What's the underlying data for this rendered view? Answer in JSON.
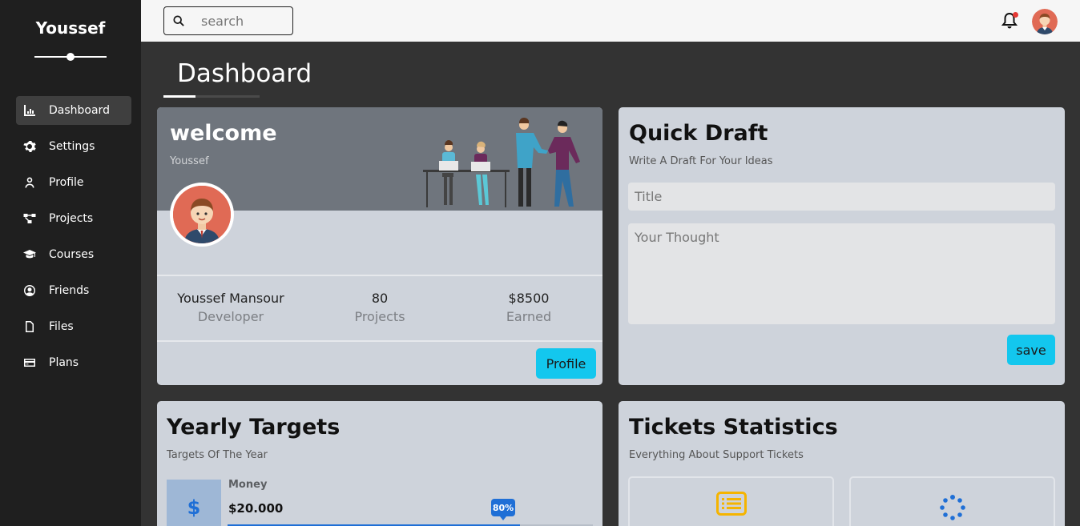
{
  "sidebar": {
    "brand": "Youssef",
    "items": [
      {
        "label": "Dashboard",
        "icon": "chart-icon",
        "active": true
      },
      {
        "label": "Settings",
        "icon": "gear-icon"
      },
      {
        "label": "Profile",
        "icon": "user-icon"
      },
      {
        "label": "Projects",
        "icon": "diagram-icon"
      },
      {
        "label": "Courses",
        "icon": "graduation-cap-icon"
      },
      {
        "label": "Friends",
        "icon": "user-circle-icon"
      },
      {
        "label": "Files",
        "icon": "file-icon"
      },
      {
        "label": "Plans",
        "icon": "credit-card-icon"
      }
    ]
  },
  "topbar": {
    "search_placeholder": "search",
    "search_icon": "search-icon",
    "bell_icon": "bell-icon",
    "avatar_icon": "avatar-icon"
  },
  "page": {
    "title": "Dashboard"
  },
  "welcome": {
    "title": "welcome",
    "subtitle": "Youssef",
    "stats": [
      {
        "value": "Youssef Mansour",
        "label": "Developer"
      },
      {
        "value": "80",
        "label": "Projects"
      },
      {
        "value": "$8500",
        "label": "Earned"
      }
    ],
    "button": "Profile"
  },
  "draft": {
    "title": "Quick Draft",
    "subtitle": "Write A Draft For Your Ideas",
    "title_placeholder": "Title",
    "thought_placeholder": "Your Thought",
    "button": "save"
  },
  "targets": {
    "title": "Yearly Targets",
    "subtitle": "Targets Of The Year",
    "symbol": "$",
    "label": "Money",
    "value": "$20.000",
    "percent_label": "80%",
    "progress": 0.8
  },
  "tickets": {
    "title": "Tickets Statistics",
    "subtitle": "Everything About Support Tickets",
    "box_icons": [
      "list-icon",
      "spinner-icon"
    ]
  },
  "colors": {
    "sidebar_bg": "#1f1f1f",
    "content_bg": "#333333",
    "card_bg": "#ced3db",
    "accent": "#13c7ee",
    "progress_blue": "#1f6fd6",
    "ticket_yellow": "#f5b400"
  }
}
